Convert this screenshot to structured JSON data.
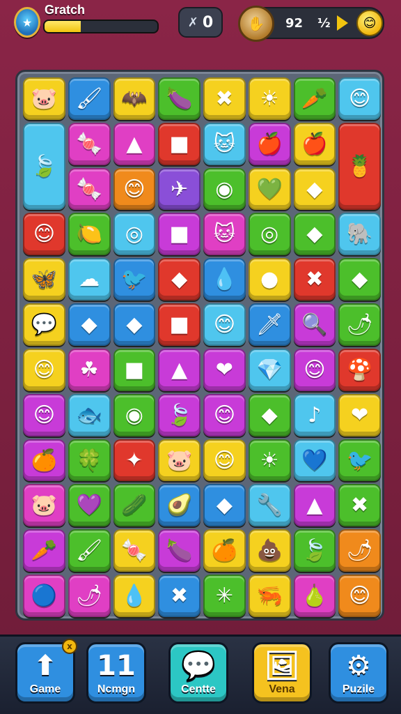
{
  "hud": {
    "level_title": "Gratch",
    "progress_fraction": 0.32,
    "moves_value": "0",
    "score_value": "92",
    "score_extra": "½",
    "avatar_icon": "shield-badge-icon",
    "moves_icon": "wrench-icon",
    "emblem_icon": "trophy-emblem-icon",
    "smiley_icon": "smiley-face-icon"
  },
  "colors": {
    "yellow": "#f5d11f",
    "blue": "#2f8fe0",
    "lightblue": "#4fc6ee",
    "green": "#4cbf2b",
    "pink": "#e03fc4",
    "magenta": "#c83bd8",
    "red": "#e0382c",
    "orange": "#f08a1c",
    "purple": "#8a4fd8",
    "cyan": "#2cc7c4",
    "lime": "#8fd42a"
  },
  "board": {
    "rows": [
      [
        [
          "yellow",
          "🐷"
        ],
        [
          "blue",
          "🖌"
        ],
        [
          "yellow",
          "🦇"
        ],
        [
          "green",
          "🍆"
        ],
        [
          "yellow",
          "✖"
        ],
        [
          "yellow",
          "☀"
        ],
        [
          "green",
          "🥕"
        ],
        [
          "lightblue",
          "😊"
        ]
      ],
      [
        [
          "lightblue",
          "🍃"
        ],
        [
          "pink",
          "🍬"
        ],
        [
          "pink",
          "▲"
        ],
        [
          "red",
          "■"
        ],
        [
          "lightblue",
          "🐱"
        ],
        [
          "magenta",
          "🍎"
        ],
        [
          "yellow",
          "🍎"
        ],
        [
          "red",
          "🍍"
        ]
      ],
      [
        [
          "pink",
          "🍬"
        ],
        [
          "orange",
          "😊"
        ],
        [
          "purple",
          "✈"
        ],
        [
          "green",
          "◉"
        ],
        [
          "yellow",
          "💚"
        ],
        [
          "yellow",
          "◆"
        ]
      ],
      [
        [
          "red",
          "😊"
        ],
        [
          "green",
          "🍋"
        ],
        [
          "lightblue",
          "◎"
        ],
        [
          "magenta",
          "■"
        ],
        [
          "pink",
          "🐱"
        ],
        [
          "green",
          "◎"
        ],
        [
          "green",
          "◆"
        ],
        [
          "lightblue",
          "🐘"
        ]
      ],
      [
        [
          "yellow",
          "🦋"
        ],
        [
          "lightblue",
          "☁"
        ],
        [
          "blue",
          "🐦"
        ],
        [
          "red",
          "◆"
        ],
        [
          "blue",
          "💧"
        ],
        [
          "yellow",
          "●"
        ],
        [
          "red",
          "✖"
        ],
        [
          "green",
          "◆"
        ]
      ],
      [
        [
          "yellow",
          "💬"
        ],
        [
          "blue",
          "◆"
        ],
        [
          "blue",
          "◆"
        ],
        [
          "red",
          "■"
        ],
        [
          "lightblue",
          "😊"
        ],
        [
          "blue",
          "🗡"
        ],
        [
          "magenta",
          "🔍"
        ],
        [
          "green",
          "🌶"
        ]
      ],
      [
        [
          "yellow",
          "😊"
        ],
        [
          "pink",
          "☘"
        ],
        [
          "green",
          "■"
        ],
        [
          "magenta",
          "▲"
        ],
        [
          "magenta",
          "❤"
        ],
        [
          "lightblue",
          "💎"
        ],
        [
          "magenta",
          "😊"
        ],
        [
          "red",
          "🍄"
        ]
      ],
      [
        [
          "magenta",
          "😊"
        ],
        [
          "lightblue",
          "🐟"
        ],
        [
          "green",
          "◉"
        ],
        [
          "magenta",
          "🍃"
        ],
        [
          "magenta",
          "😊"
        ],
        [
          "green",
          "◆"
        ],
        [
          "lightblue",
          "♪"
        ],
        [
          "yellow",
          "❤"
        ]
      ],
      [
        [
          "magenta",
          "🍊"
        ],
        [
          "green",
          "🍀"
        ],
        [
          "red",
          "✦"
        ],
        [
          "yellow",
          "🐷"
        ],
        [
          "yellow",
          "😊"
        ],
        [
          "green",
          "☀"
        ],
        [
          "lightblue",
          "💙"
        ],
        [
          "green",
          "🐦"
        ]
      ],
      [
        [
          "pink",
          "🐷"
        ],
        [
          "green",
          "💜"
        ],
        [
          "green",
          "🥒"
        ],
        [
          "blue",
          "🥑"
        ],
        [
          "blue",
          "◆"
        ],
        [
          "lightblue",
          "🔧"
        ],
        [
          "magenta",
          "▲"
        ],
        [
          "green",
          "✖"
        ]
      ],
      [
        [
          "magenta",
          "🥕"
        ],
        [
          "green",
          "🖌"
        ],
        [
          "yellow",
          "🍬"
        ],
        [
          "magenta",
          "🍆"
        ],
        [
          "yellow",
          "🍊"
        ],
        [
          "yellow",
          "💩"
        ],
        [
          "green",
          "🍃"
        ],
        [
          "orange",
          "🌶"
        ]
      ],
      [
        [
          "pink",
          "🔵"
        ],
        [
          "pink",
          "🌶"
        ],
        [
          "yellow",
          "💧"
        ],
        [
          "blue",
          "✖"
        ],
        [
          "green",
          "✳"
        ],
        [
          "yellow",
          "🦐"
        ],
        [
          "pink",
          "🍐"
        ],
        [
          "orange",
          "😊"
        ]
      ]
    ]
  },
  "bottom_nav": [
    {
      "label": "Game",
      "icon": "⬆",
      "icon_name": "home-arrow-icon",
      "color": "#2f8fe0",
      "badge": "x"
    },
    {
      "label": "Ncmgn",
      "icon": "11",
      "icon_name": "counter-icon",
      "color": "#2f8fe0",
      "badge": ""
    },
    {
      "label": "Centte",
      "icon": "💬",
      "icon_name": "chat-bubble-icon",
      "color": "#2cc7c4",
      "badge": ""
    },
    {
      "label": "Vena",
      "icon": "🖼",
      "icon_name": "picture-frame-icon",
      "color": "#f5c21f",
      "badge": ""
    },
    {
      "label": "Puzile",
      "icon": "⚙",
      "icon_name": "gear-icon",
      "color": "#2f8fe0",
      "badge": ""
    }
  ]
}
